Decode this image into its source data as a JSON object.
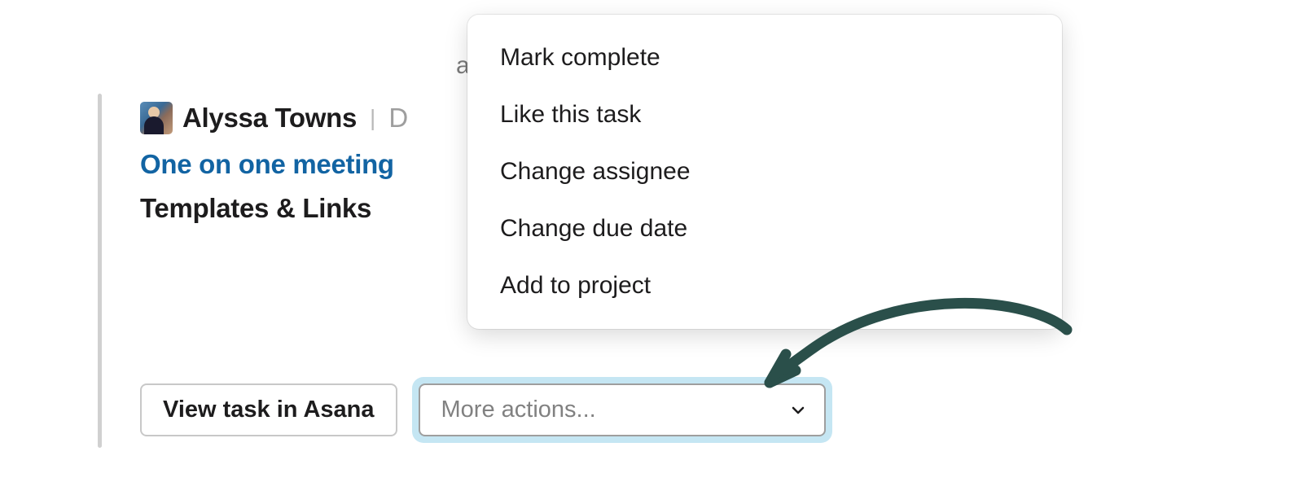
{
  "user_name": "Alyssa Towns",
  "due_partial": "D",
  "task_link": "One on one meeting",
  "section_title": "Templates & Links",
  "buttons": {
    "view_task": "View task in Asana",
    "more_actions": "More actions..."
  },
  "menu": {
    "items": [
      "Mark complete",
      "Like this task",
      "Change assignee",
      "Change due date",
      "Add to project"
    ]
  }
}
